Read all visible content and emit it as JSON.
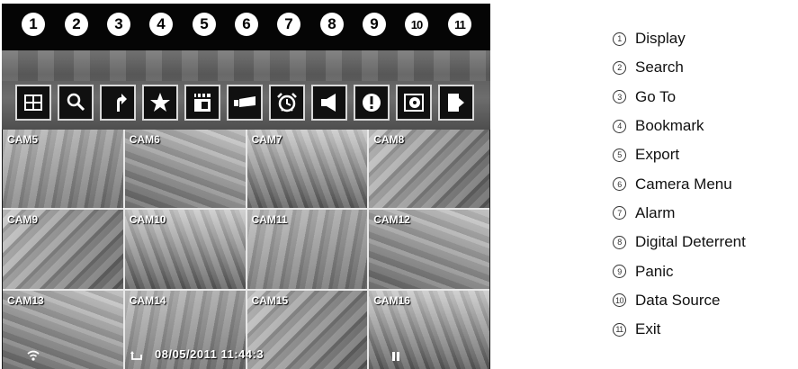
{
  "toolbar": {
    "numbers": [
      "1",
      "2",
      "3",
      "4",
      "5",
      "6",
      "7",
      "8",
      "9",
      "10",
      "11"
    ],
    "buttons": [
      {
        "icon": "display-grid-icon"
      },
      {
        "icon": "search-magnifier-icon"
      },
      {
        "icon": "goto-arrow-icon"
      },
      {
        "icon": "bookmark-star-icon"
      },
      {
        "icon": "export-clapper-icon"
      },
      {
        "icon": "camera-menu-icon"
      },
      {
        "icon": "alarm-clock-icon"
      },
      {
        "icon": "speaker-icon"
      },
      {
        "icon": "panic-exclamation-icon"
      },
      {
        "icon": "data-source-disc-icon"
      },
      {
        "icon": "exit-door-icon"
      }
    ]
  },
  "cameras": [
    "CAM5",
    "CAM6",
    "CAM7",
    "CAM8",
    "CAM9",
    "CAM10",
    "CAM11",
    "CAM12",
    "CAM13",
    "CAM14",
    "CAM15",
    "CAM16"
  ],
  "status": {
    "datetime": "08/05/2011  11:44:3",
    "wifi_icon": "wifi-icon",
    "playback_icon": "playback-icon",
    "pause_icon": "pause-icon"
  },
  "legend": [
    {
      "num": "1",
      "label": "Display"
    },
    {
      "num": "2",
      "label": "Search"
    },
    {
      "num": "3",
      "label": "Go To"
    },
    {
      "num": "4",
      "label": "Bookmark"
    },
    {
      "num": "5",
      "label": "Export"
    },
    {
      "num": "6",
      "label": "Camera Menu"
    },
    {
      "num": "7",
      "label": "Alarm"
    },
    {
      "num": "8",
      "label": "Digital Deterrent"
    },
    {
      "num": "9",
      "label": "Panic"
    },
    {
      "num": "10",
      "label": "Data Source"
    },
    {
      "num": "11",
      "label": "Exit"
    }
  ]
}
